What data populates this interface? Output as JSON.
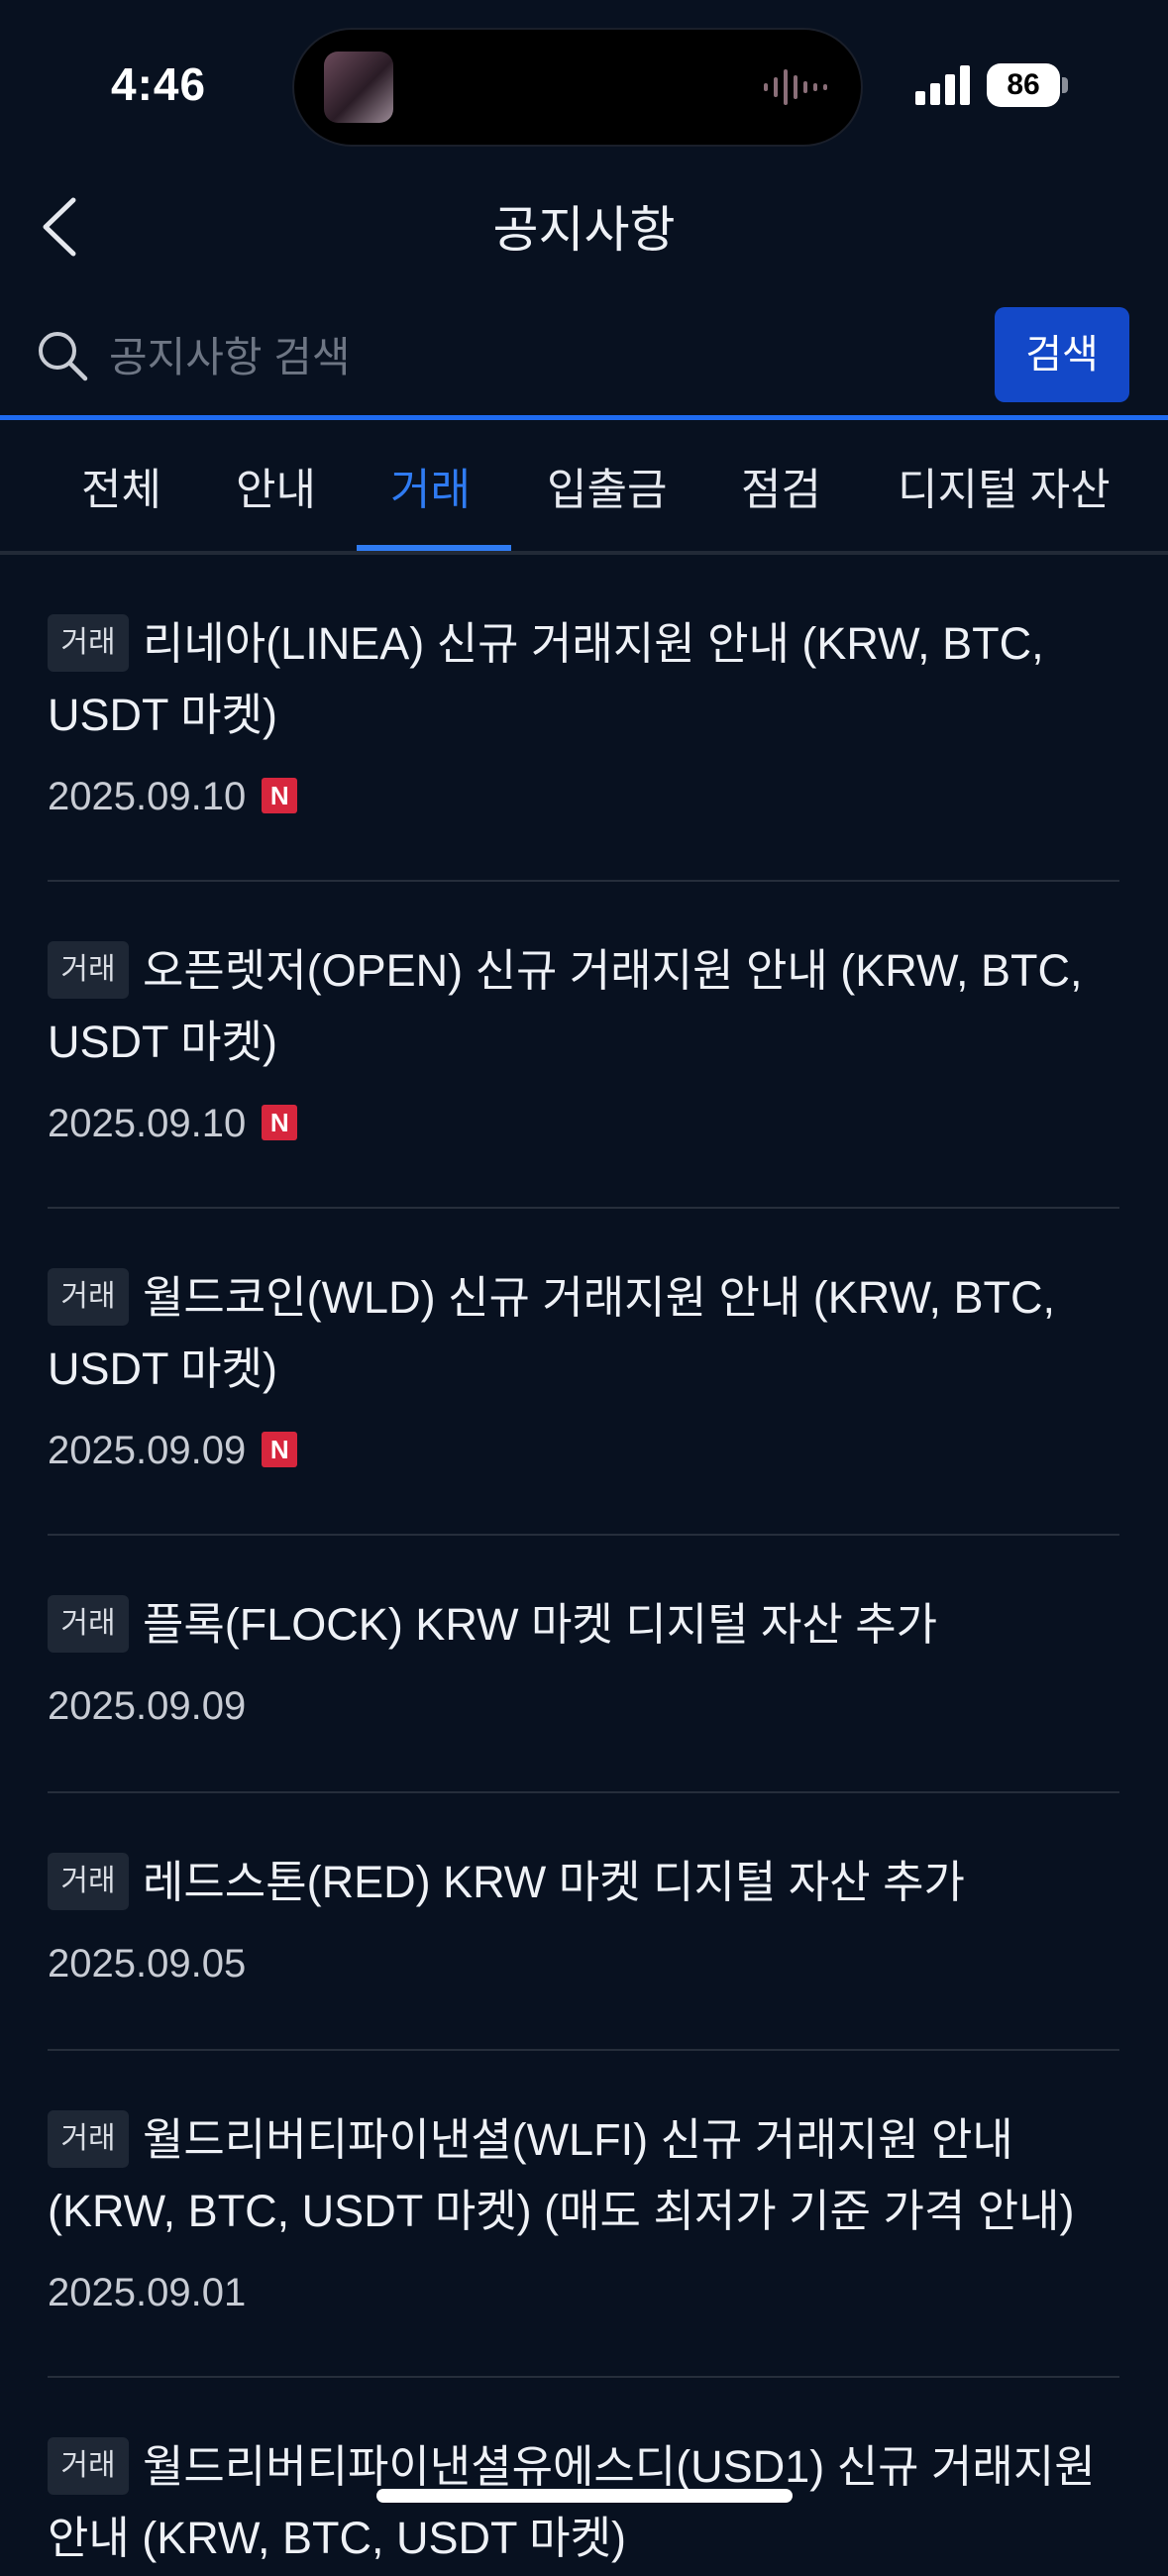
{
  "status_bar": {
    "time": "4:46",
    "battery": "86"
  },
  "header": {
    "title": "공지사항"
  },
  "search": {
    "placeholder": "공지사항 검색",
    "button_label": "검색"
  },
  "tabs": [
    {
      "label": "전체"
    },
    {
      "label": "안내"
    },
    {
      "label": "거래"
    },
    {
      "label": "입출금"
    },
    {
      "label": "점검"
    },
    {
      "label": "디지털 자산"
    }
  ],
  "active_tab": "거래",
  "notices": [
    {
      "category": "거래",
      "title": "리네아(LINEA) 신규 거래지원 안내 (KRW, BTC, USDT 마켓)",
      "date": "2025.09.10",
      "new": "N"
    },
    {
      "category": "거래",
      "title": "오픈렛저(OPEN) 신규 거래지원 안내 (KRW, BTC, USDT 마켓)",
      "date": "2025.09.10",
      "new": "N"
    },
    {
      "category": "거래",
      "title": "월드코인(WLD) 신규 거래지원 안내 (KRW, BTC, USDT 마켓)",
      "date": "2025.09.09",
      "new": "N"
    },
    {
      "category": "거래",
      "title": "플록(FLOCK) KRW 마켓 디지털 자산 추가",
      "date": "2025.09.09"
    },
    {
      "category": "거래",
      "title": "레드스톤(RED) KRW 마켓 디지털 자산 추가",
      "date": "2025.09.05"
    },
    {
      "category": "거래",
      "title": "월드리버티파이낸셜(WLFI) 신규 거래지원 안내 (KRW, BTC, USDT 마켓) (매도 최저가 기준 가격 안내)",
      "date": "2025.09.01"
    },
    {
      "category": "거래",
      "title": "월드리버티파이낸셜유에스디(USD1) 신규 거래지원 안내 (KRW, BTC, USDT 마켓)"
    }
  ],
  "colors": {
    "background": "#081120",
    "accent": "#2f7bf2",
    "new_badge": "#d7263d",
    "search_button": "#1348c8"
  }
}
